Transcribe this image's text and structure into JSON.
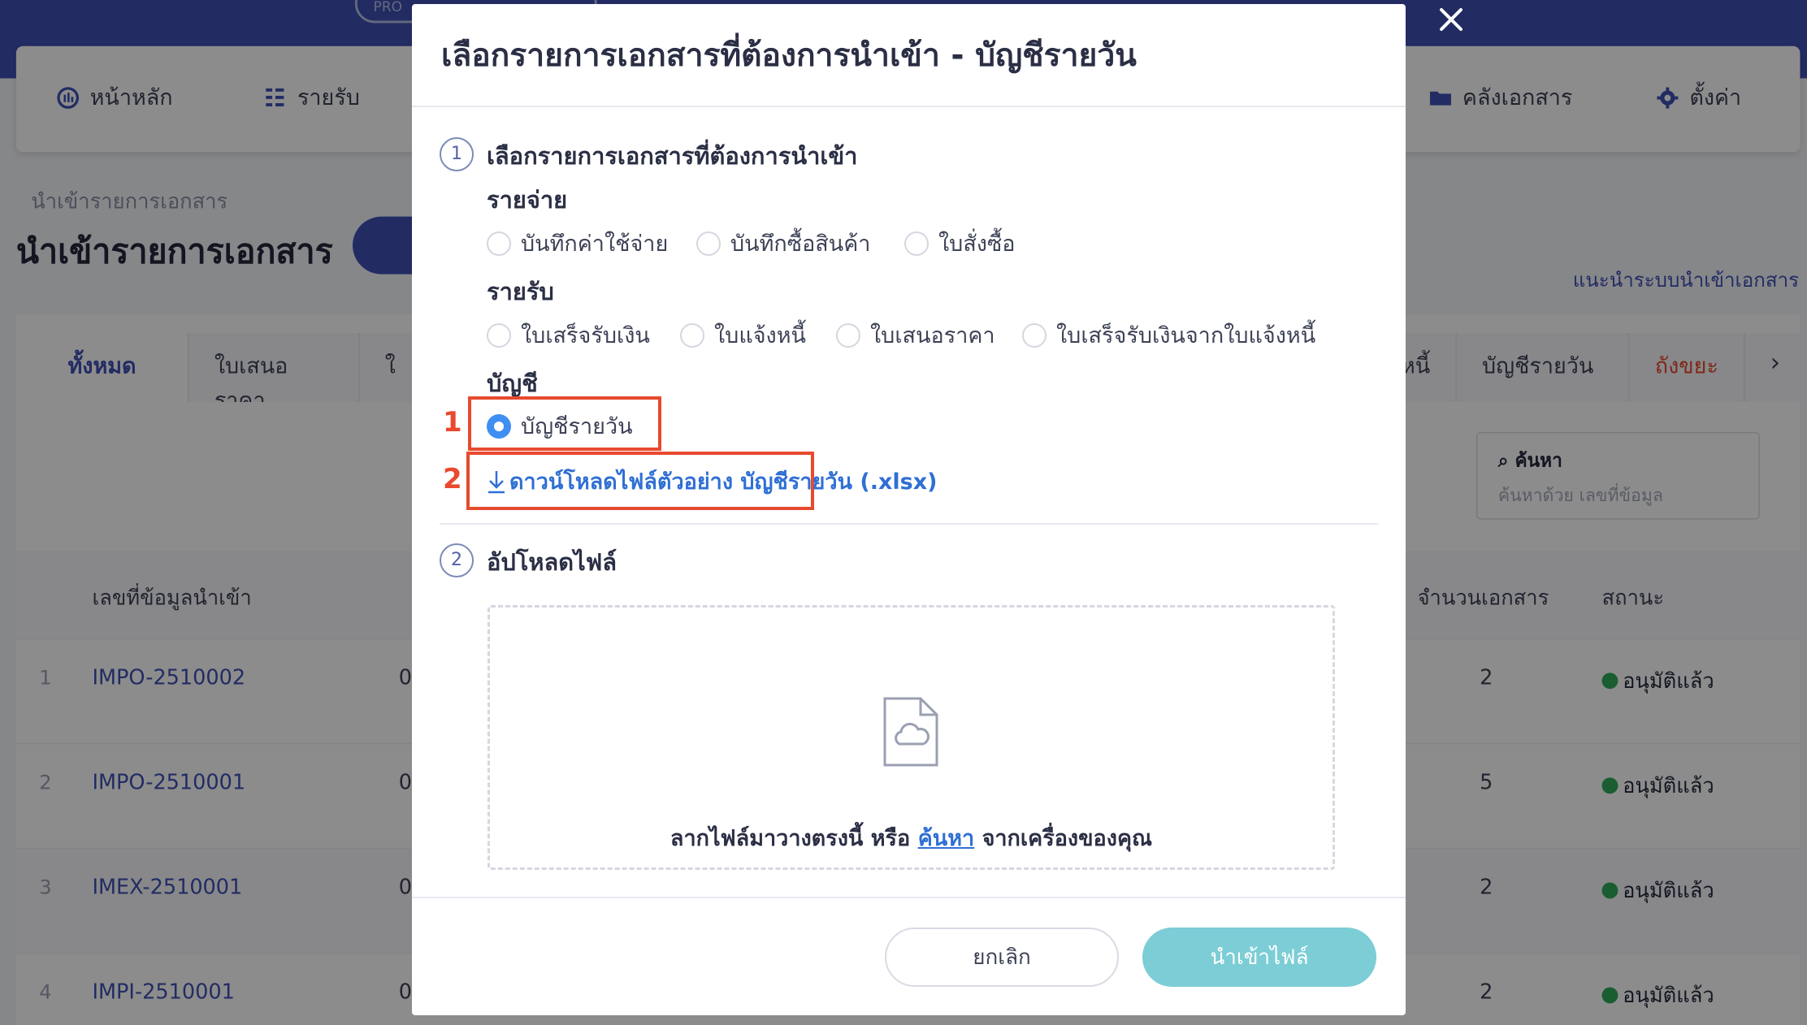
{
  "background": {
    "pro_badge": "PRO",
    "nav": {
      "home": "หน้าหลัก",
      "income": "รายรับ",
      "documents": "คลังเอกสาร",
      "settings": "ตั้งค่า"
    },
    "breadcrumb": "นำเข้ารายการเอกสาร",
    "page_title": "นำเข้ารายการเอกสาร",
    "guide_link": "แนะนำระบบนำเข้าเอกสาร",
    "tabs": [
      "ทั้งหมด",
      "ใบเสนอราคา",
      "ใ",
      "หนี้",
      "บัญชีรายวัน",
      "ถังขยะ"
    ],
    "search": {
      "label": "ค้นหา",
      "placeholder": "ค้นหาด้วย เลขที่ข้อมูล"
    },
    "table": {
      "headers": {
        "id": "เลขที่ข้อมูลนำเข้า",
        "count": "จำนวนเอกสาร",
        "status": "สถานะ"
      },
      "rows": [
        {
          "no": "1",
          "id": "IMPO-2510002",
          "col": "0",
          "count": "2",
          "status": "อนุมัติแล้ว"
        },
        {
          "no": "2",
          "id": "IMPO-2510001",
          "col": "0",
          "count": "5",
          "status": "อนุมัติแล้ว"
        },
        {
          "no": "3",
          "id": "IMEX-2510001",
          "col": "0",
          "count": "2",
          "status": "อนุมัติแล้ว"
        },
        {
          "no": "4",
          "id": "IMPI-2510001",
          "col": "0",
          "count": "2",
          "status": "อนุมัติแล้ว"
        }
      ]
    }
  },
  "modal": {
    "title": "เลือกรายการเอกสารที่ต้องการนำเข้า - บัญชีรายวัน",
    "step1": {
      "number": "1",
      "title": "เลือกรายการเอกสารที่ต้องการนำเข้า"
    },
    "groups": {
      "expense": {
        "label": "รายจ่าย",
        "options": [
          "บันทึกค่าใช้จ่าย",
          "บันทึกซื้อสินค้า",
          "ใบสั่งซื้อ"
        ]
      },
      "income": {
        "label": "รายรับ",
        "options": [
          "ใบเสร็จรับเงิน",
          "ใบแจ้งหนี้",
          "ใบเสนอราคา",
          "ใบเสร็จรับเงินจากใบแจ้งหนี้"
        ]
      },
      "account": {
        "label": "บัญชี",
        "options": [
          "บัญชีรายวัน"
        ],
        "selected": "บัญชีรายวัน"
      }
    },
    "download_link": "ดาวน์โหลดไฟล์ตัวอย่าง บัญชีรายวัน (.xlsx)",
    "annotations": [
      "1",
      "2"
    ],
    "step2": {
      "number": "2",
      "title": "อัปโหลดไฟล์"
    },
    "dropzone": {
      "text_before": "ลากไฟล์มาวางตรงนี้ หรือ ",
      "link": "ค้นหา",
      "text_after": " จากเครื่องของคุณ"
    },
    "buttons": {
      "cancel": "ยกเลิก",
      "import": "นำเข้าไฟล์"
    },
    "colors": {
      "accent": "#3f51b5",
      "highlight": "#e84a2f",
      "import_button": "#7ccdd6",
      "link": "#2f6fd4"
    }
  }
}
